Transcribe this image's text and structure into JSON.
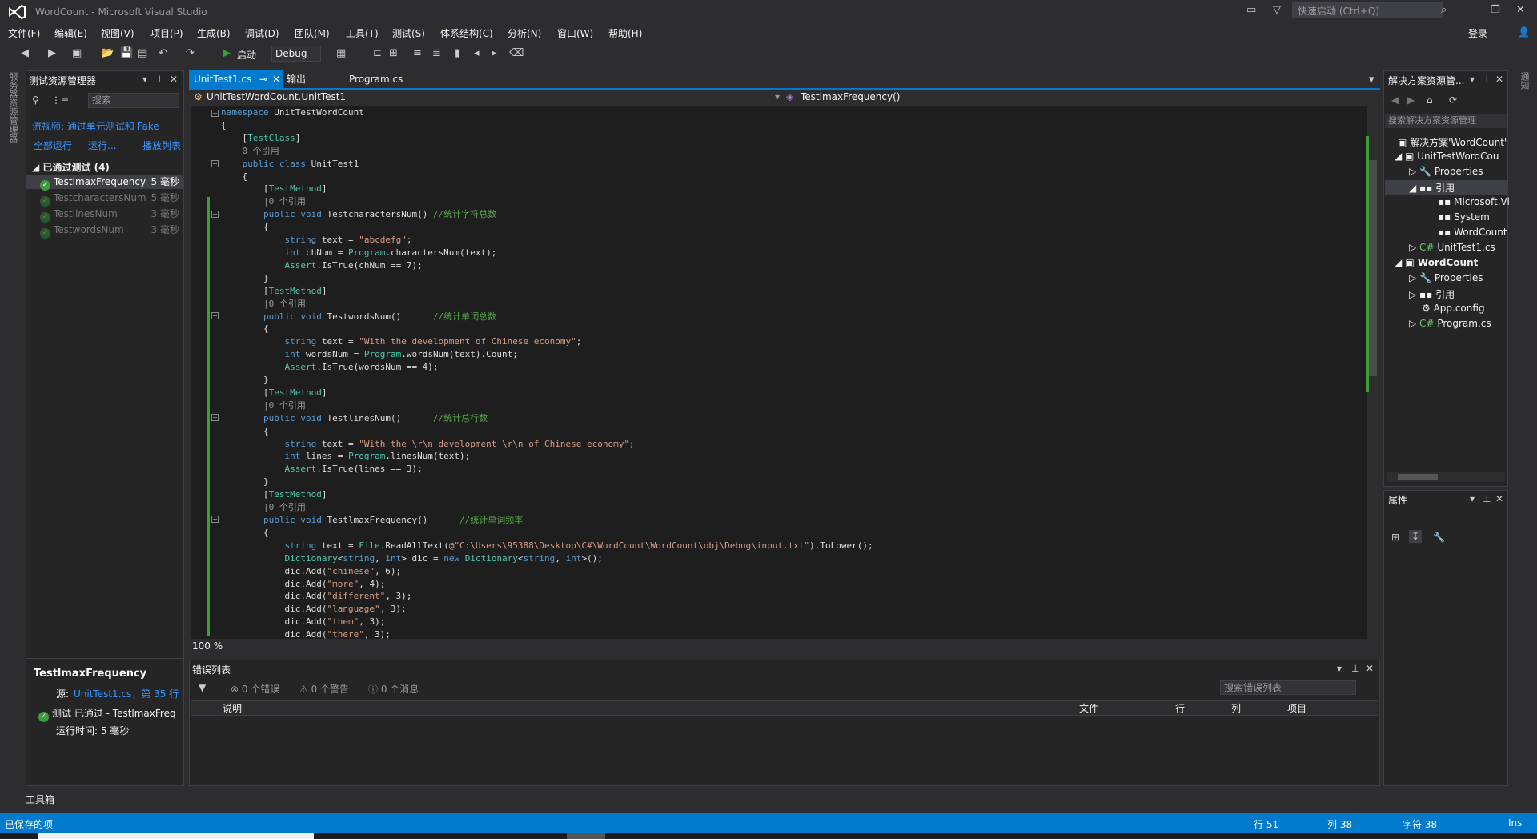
{
  "window": {
    "title": "WordCount - Microsoft Visual Studio",
    "quick_launch_placeholder": "快速启动 (Ctrl+Q)",
    "login": "登录"
  },
  "menu": [
    "文件(F)",
    "编辑(E)",
    "视图(V)",
    "项目(P)",
    "生成(B)",
    "调试(D)",
    "团队(M)",
    "工具(T)",
    "测试(S)",
    "体系结构(C)",
    "分析(N)",
    "窗口(W)",
    "帮助(H)"
  ],
  "toolbar": {
    "start_label": "启动",
    "config": "Debug"
  },
  "left_strip": {
    "label": "服务器资源管理器"
  },
  "test_explorer": {
    "title": "测试资源管理器",
    "search_placeholder": "搜索",
    "notice": "流视频: 通过单元测试和 Fake",
    "run_all": "全部运行",
    "run": "运行...",
    "playlist": "播放列表",
    "group_label": "已通过测试 (4)",
    "tests": [
      {
        "name": "TestlmaxFrequency",
        "time": "5 毫秒"
      },
      {
        "name": "TestcharactersNum",
        "time": "5 毫秒"
      },
      {
        "name": "TestlinesNum",
        "time": "3 毫秒"
      },
      {
        "name": "TestwordsNum",
        "time": "3 毫秒"
      }
    ],
    "detail": {
      "name": "TestlmaxFrequency",
      "source_label": "源:",
      "source_link": "UnitTest1.cs，第 35 行",
      "result": "测试 已通过 - TestlmaxFreq",
      "runtime": "运行时间: 5 毫秒"
    }
  },
  "editor": {
    "tabs": [
      "UnitTest1.cs",
      "输出",
      "Program.cs"
    ],
    "nav_left": "UnitTestWordCount.UnitTest1",
    "nav_right": "TestlmaxFrequency()",
    "zoom": "100 %",
    "code_lines": [
      "namespace UnitTestWordCount",
      "{",
      "    [TestClass]",
      "    0 个引用",
      "    public class UnitTest1",
      "    {",
      "        [TestMethod]",
      "        |0 个引用",
      "        public void TestcharactersNum() //统计字符总数",
      "        {",
      "            string text = \"abcdefg\";",
      "            int chNum = Program.charactersNum(text);",
      "            Assert.IsTrue(chNum == 7);",
      "        }",
      "        [TestMethod]",
      "        |0 个引用",
      "        public void TestwordsNum()      //统计单词总数",
      "        {",
      "            string text = \"With the development of Chinese economy\";",
      "            int wordsNum = Program.wordsNum(text).Count;",
      "            Assert.IsTrue(wordsNum == 4);",
      "        }",
      "        [TestMethod]",
      "        |0 个引用",
      "        public void TestlinesNum()      //统计总行数",
      "        {",
      "            string text = \"With the \\r\\n development \\r\\n of Chinese economy\";",
      "            int lines = Program.linesNum(text);",
      "            Assert.IsTrue(lines == 3);",
      "        }",
      "        [TestMethod]",
      "        |0 个引用",
      "        public void TestlmaxFrequency()      //统计单词频率",
      "        {",
      "            string text = File.ReadAllText(@\"C:\\Users\\95388\\Desktop\\C#\\WordCount\\WordCount\\obj\\Debug\\input.txt\").ToLower();",
      "            Dictionary<string, int> dic = new Dictionary<string, int>();",
      "            dic.Add(\"chinese\", 6);",
      "            dic.Add(\"more\", 4);",
      "            dic.Add(\"different\", 3);",
      "            dic.Add(\"language\", 3);",
      "            dic.Add(\"them\", 3);",
      "            dic.Add(\"there\", 3);"
    ]
  },
  "error_list": {
    "title": "错误列表",
    "errors": "0 个错误",
    "warnings": "0 个警告",
    "messages": "0 个消息",
    "search_placeholder": "搜索错误列表",
    "columns": [
      "说明",
      "文件",
      "行",
      "列",
      "项目"
    ]
  },
  "solution_explorer": {
    "title": "解决方案资源管...",
    "search_placeholder": "搜索解决方案资源管理",
    "tree": [
      {
        "label": "解决方案'WordCount'",
        "level": 0
      },
      {
        "label": "UnitTestWordCou",
        "level": 1
      },
      {
        "label": "Properties",
        "level": 2
      },
      {
        "label": "引用",
        "level": 2
      },
      {
        "label": "Microsoft.Vi",
        "level": 3
      },
      {
        "label": "System",
        "level": 3
      },
      {
        "label": "WordCount",
        "level": 3
      },
      {
        "label": "UnitTest1.cs",
        "level": 2
      },
      {
        "label": "WordCount",
        "level": 1
      },
      {
        "label": "Properties",
        "level": 2
      },
      {
        "label": "引用",
        "level": 2
      },
      {
        "label": "App.config",
        "level": 2
      },
      {
        "label": "Program.cs",
        "level": 2
      }
    ]
  },
  "properties": {
    "title": "属性"
  },
  "right_strip": {
    "label": "通知"
  },
  "toolbox": {
    "label": "工具箱"
  },
  "status": {
    "left": "已保存的项",
    "row": "行 51",
    "col": "列 38",
    "char": "字符 38",
    "mode": "Ins"
  },
  "colors": {
    "accent": "#007acc",
    "pass": "#3c9e3c",
    "background": "#2d2d30",
    "editor": "#1e1e1e"
  }
}
